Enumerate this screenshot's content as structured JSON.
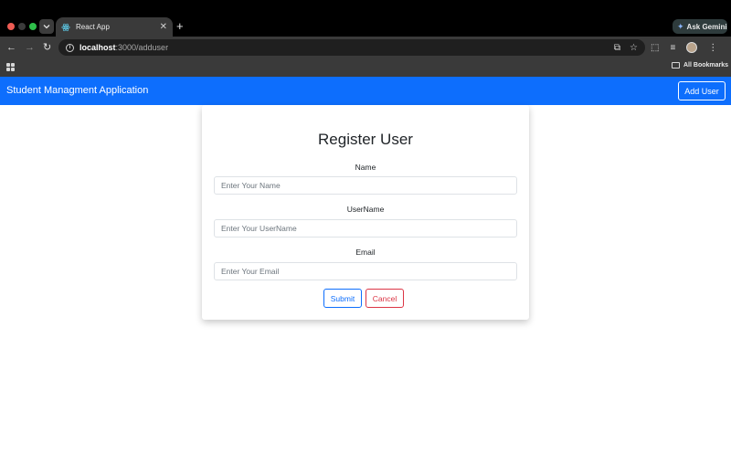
{
  "browser": {
    "tab_title": "React App",
    "url_host": "localhost",
    "url_path": ":3000/adduser",
    "gemini_label": "Ask Gemini",
    "bookmarks_label": "All Bookmarks"
  },
  "navbar": {
    "brand": "Student Managment Application",
    "add_user_label": "Add User",
    "color": "#0d6efd"
  },
  "form": {
    "title": "Register User",
    "fields": [
      {
        "label": "Name",
        "placeholder": "Enter Your Name",
        "value": ""
      },
      {
        "label": "UserName",
        "placeholder": "Enter Your UserName",
        "value": ""
      },
      {
        "label": "Email",
        "placeholder": "Enter Your Email",
        "value": ""
      }
    ],
    "submit_label": "Submit",
    "cancel_label": "Cancel",
    "colors": {
      "primary": "#0d6efd",
      "danger": "#dc3545"
    }
  }
}
